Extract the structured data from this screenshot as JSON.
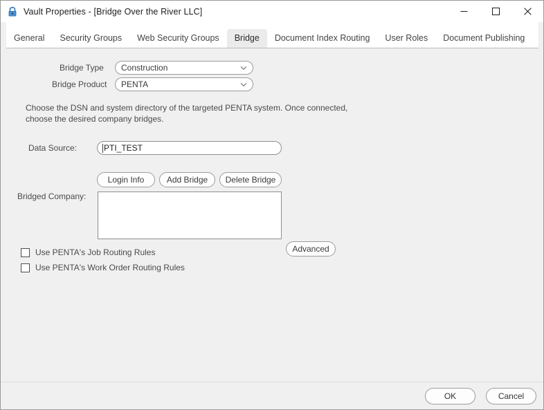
{
  "window": {
    "title": "Vault Properties - [Bridge Over the River LLC]",
    "icon": "lock-icon",
    "controls": {
      "minimize": "minimize-icon",
      "maximize": "maximize-icon",
      "close": "close-icon"
    }
  },
  "tabs": [
    {
      "label": "General",
      "selected": false
    },
    {
      "label": "Security Groups",
      "selected": false
    },
    {
      "label": "Web Security Groups",
      "selected": false
    },
    {
      "label": "Bridge",
      "selected": true
    },
    {
      "label": "Document Index Routing",
      "selected": false
    },
    {
      "label": "User Roles",
      "selected": false
    },
    {
      "label": "Document Publishing",
      "selected": false
    }
  ],
  "form": {
    "bridge_type": {
      "label": "Bridge Type",
      "value": "Construction",
      "arrow_icon": "chevron-down-icon"
    },
    "bridge_product": {
      "label": "Bridge Product",
      "value": "PENTA",
      "arrow_icon": "chevron-down-icon"
    },
    "description": "Choose the DSN and system directory of the targeted PENTA system.  Once connected,\nchoose the desired company bridges.",
    "data_source": {
      "label": "Data Source:",
      "value": "PTI_TEST",
      "placeholder": ""
    },
    "actions": {
      "login_info": "Login Info",
      "add_bridge": "Add Bridge",
      "delete_bridge": "Delete Bridge"
    },
    "bridged_company": {
      "label": "Bridged Company:",
      "items": []
    },
    "advanced_button": "Advanced",
    "checkboxes": [
      {
        "label": "Use PENTA's Job Routing Rules",
        "checked": false
      },
      {
        "label": "Use PENTA's Work Order Routing Rules",
        "checked": false
      }
    ]
  },
  "footer": {
    "ok": "OK",
    "cancel": "Cancel"
  },
  "colors": {
    "window_bg": "#f0f0f0",
    "tabstrip_bg": "#ffffff",
    "selected_tab_bg": "#ebebeb",
    "field_bg": "#ffffff",
    "border": "#9c9c9c",
    "text": "#4a4a4a",
    "lock_icon": "#2f6fb0"
  }
}
